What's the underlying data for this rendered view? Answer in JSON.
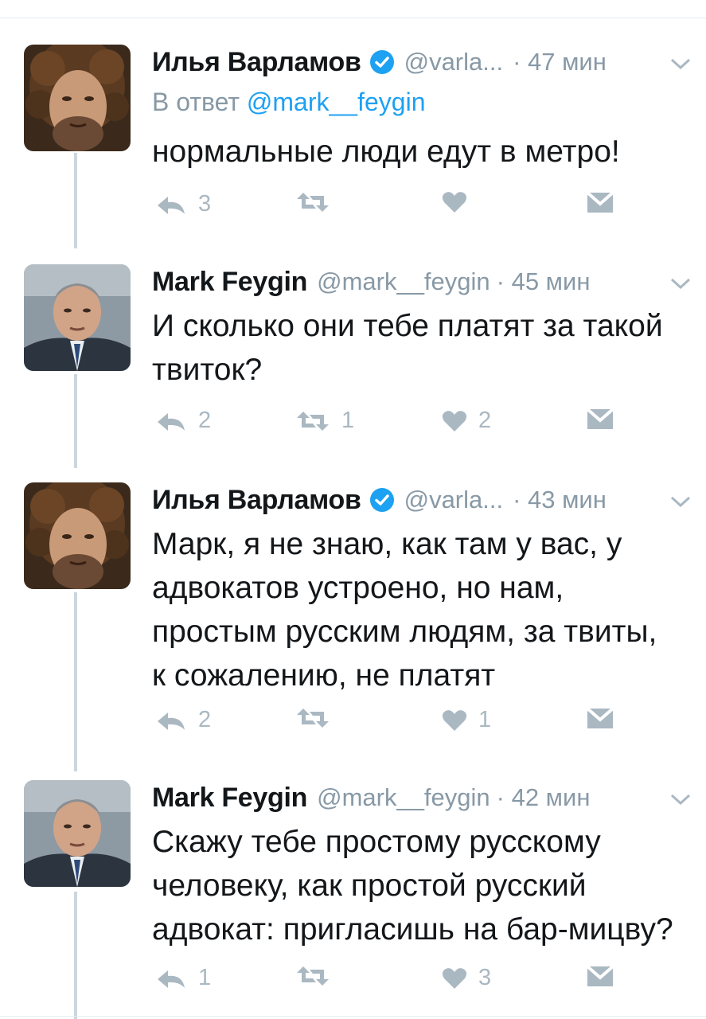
{
  "tweets": [
    {
      "author": "Илья Варламов",
      "verified": true,
      "handle": "@varla...",
      "time": "· 47 мин",
      "reply_prefix": "В ответ ",
      "reply_mention": "@mark__feygin",
      "text": "нормальные люди едут в метро!",
      "replies": "3",
      "retweets": "",
      "likes": ""
    },
    {
      "author": "Mark Feygin",
      "verified": false,
      "handle": "@mark__feygin",
      "time": "· 45 мин",
      "text": "И сколько они тебе платят за такой\nтвиток?",
      "replies": "2",
      "retweets": "1",
      "likes": "2"
    },
    {
      "author": "Илья Варламов",
      "verified": true,
      "handle": "@varla...",
      "time": "· 43 мин",
      "text": "Марк, я не знаю, как там у вас, у\nадвокатов устроено, но нам,\nпростым русским людям, за твиты,\nк сожалению, не платят",
      "replies": "2",
      "retweets": "",
      "likes": "1"
    },
    {
      "author": "Mark Feygin",
      "verified": false,
      "handle": "@mark__feygin",
      "time": "· 42 мин",
      "text": "Скажу тебе простому русскому\nчеловеку, как простой русский\nадвокат: пригласишь на бар-мицву?",
      "replies": "1",
      "retweets": "",
      "likes": "3"
    }
  ],
  "colors": {
    "text": "#14171a",
    "muted": "#8899a6",
    "link": "#1da1f2",
    "action": "#aab8c2",
    "thread_line": "#ccd6dd",
    "verified": "#1da1f2"
  },
  "icons": {
    "verified": "verified-badge-icon",
    "more": "chevron-down-icon",
    "reply": "reply-icon",
    "retweet": "retweet-icon",
    "like": "heart-icon",
    "dm": "envelope-icon"
  }
}
